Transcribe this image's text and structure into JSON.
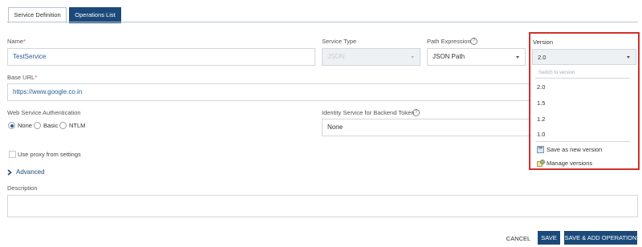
{
  "tabs": [
    {
      "label": "Service Definition",
      "active": true
    },
    {
      "label": "Operations List",
      "active": false
    }
  ],
  "form": {
    "name": {
      "label": "Name",
      "required_mark": "*",
      "value": "TestService"
    },
    "service_type": {
      "label": "Service Type",
      "value": "JSON"
    },
    "path_expression": {
      "label": "Path Expression",
      "help": "?",
      "value": "JSON Path"
    },
    "version": {
      "label": "Version",
      "value": "2.0"
    },
    "base_url": {
      "label": "Base URL",
      "required_mark": "*",
      "value": "https://www.google.co.in"
    },
    "auth": {
      "label": "Web Service Authentication",
      "options": [
        "None",
        "Basic",
        "NTLM"
      ],
      "selected": "None"
    },
    "identity_service": {
      "label": "Identity Service for Backend Token",
      "help": "?",
      "value": "None"
    },
    "use_proxy": {
      "label": "Use proxy from settings",
      "checked": false
    },
    "advanced": {
      "label": "Advanced",
      "expanded": false
    },
    "description": {
      "label": "Description",
      "value": ""
    }
  },
  "version_dropdown": {
    "search_placeholder": "Switch to version",
    "versions": [
      "2.0",
      "1.5",
      "1.2",
      "1.0"
    ],
    "actions": [
      {
        "label": "Save as new version",
        "icon": "save-icon"
      },
      {
        "label": "Manage versions",
        "icon": "manage-icon"
      }
    ],
    "highlight_color": "#d0312d"
  },
  "footer": {
    "cancel": "CANCEL",
    "save": "SAVE",
    "save_add": "SAVE & ADD OPERATION"
  },
  "colors": {
    "primary": "#1b4a7a",
    "link_text": "#2a5f93",
    "required": "#d9534f"
  }
}
